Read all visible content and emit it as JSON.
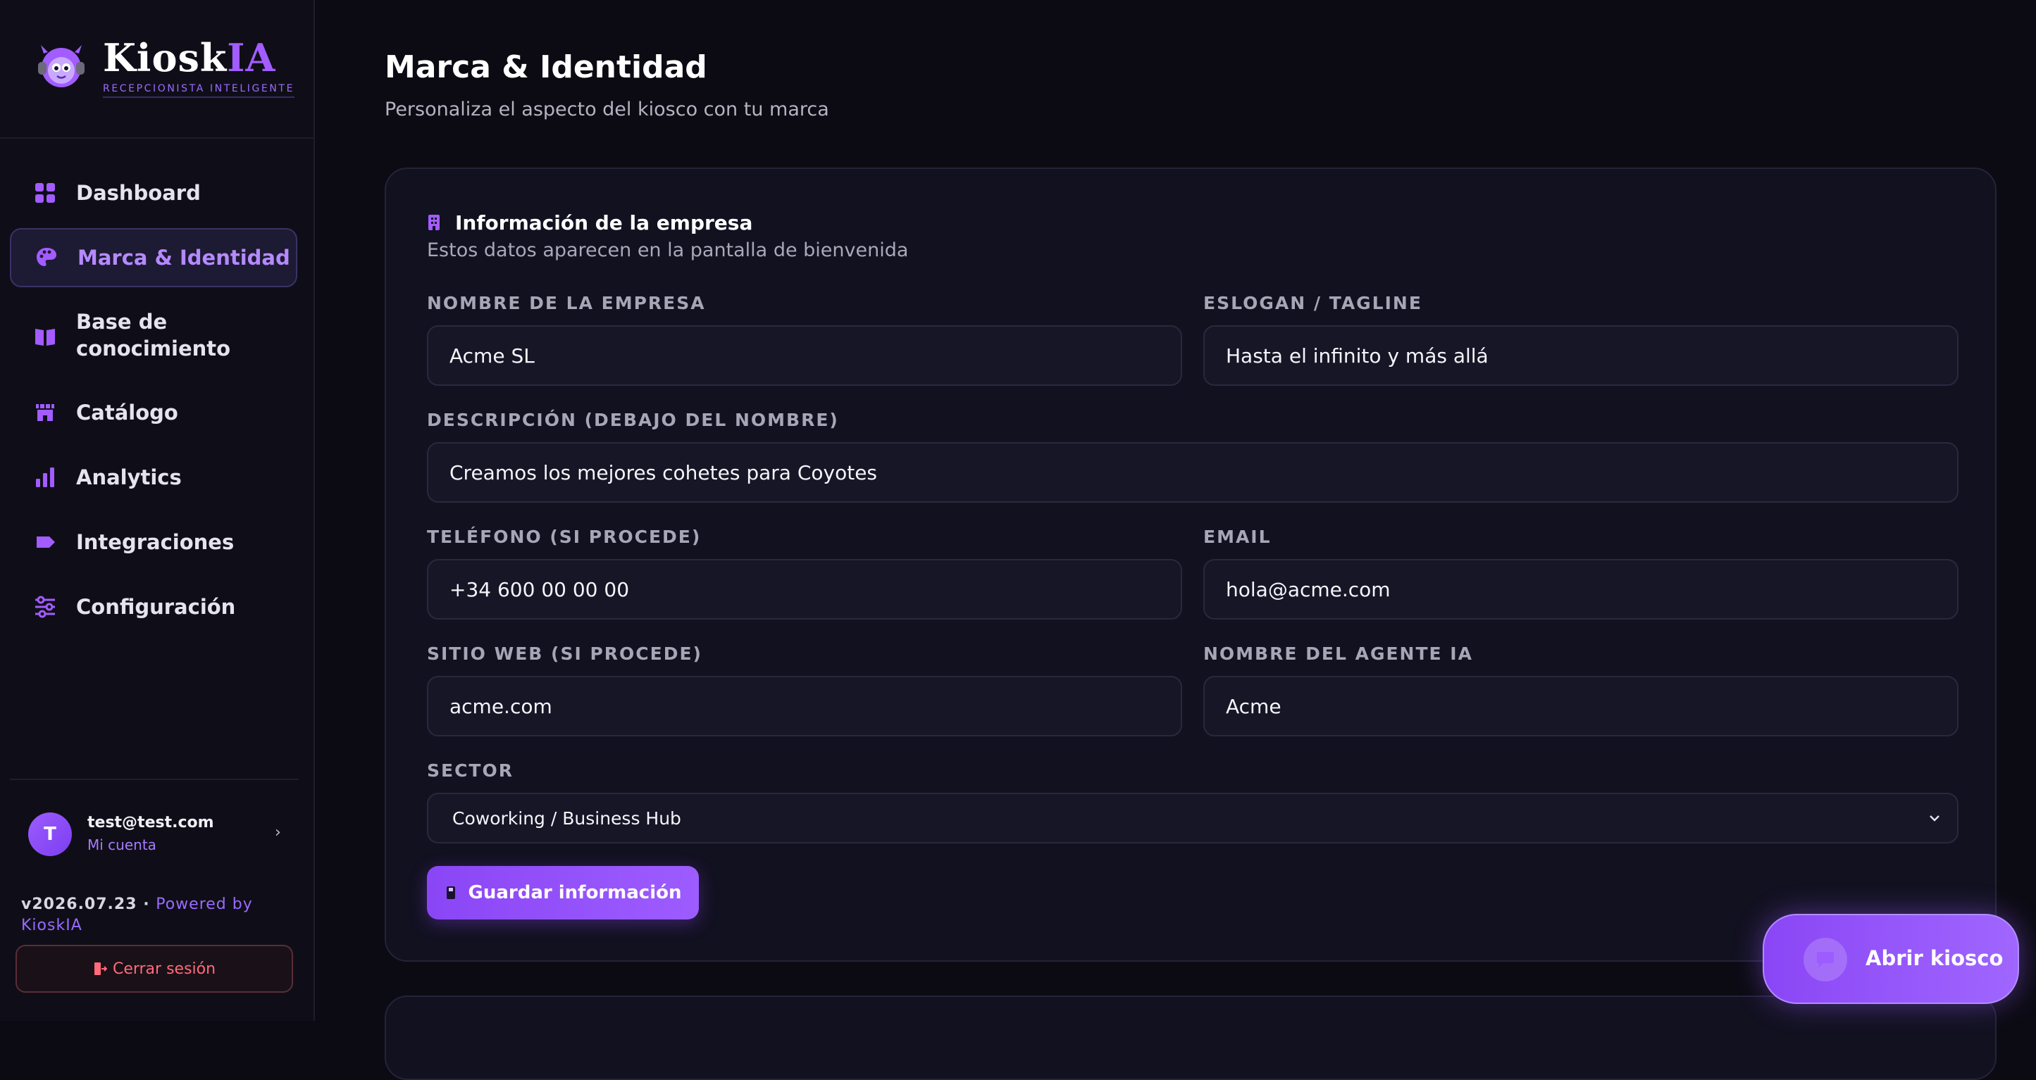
{
  "brand": {
    "name_main": "Kiosk",
    "name_accent": "IA",
    "subtitle": "RECEPCIONISTA INTELIGENTE"
  },
  "sidebar": {
    "items": [
      {
        "label": "Dashboard",
        "icon": "grid-icon",
        "active": false
      },
      {
        "label": "Marca & Identidad",
        "icon": "palette-icon",
        "active": true
      },
      {
        "label": "Base de\nconocimiento",
        "icon": "book-icon",
        "active": false
      },
      {
        "label": "Catálogo",
        "icon": "store-icon",
        "active": false
      },
      {
        "label": "Analytics",
        "icon": "bar-chart-icon",
        "active": false
      },
      {
        "label": "Integraciones",
        "icon": "plug-icon",
        "active": false
      },
      {
        "label": "Configuración",
        "icon": "sliders-icon",
        "active": false
      }
    ],
    "user": {
      "initial": "T",
      "email": "test@test.com",
      "account_label": "Mi cuenta"
    },
    "version": "v2026.07.23",
    "powered_by": "Powered by KioskIA",
    "logout_label": "Cerrar sesión"
  },
  "main": {
    "title": "Marca & Identidad",
    "subtitle": "Personaliza el aspecto del kiosco con tu marca",
    "card": {
      "title": "Información de la empresa",
      "description": "Estos datos aparecen en la pantalla de bienvenida",
      "fields": {
        "company_name": {
          "label": "NOMBRE DE LA EMPRESA",
          "value": "Acme SL"
        },
        "tagline": {
          "label": "ESLOGAN / TAGLINE",
          "value": "Hasta el infinito y más allá"
        },
        "description": {
          "label": "DESCRIPCIÓN (DEBAJO DEL NOMBRE)",
          "value": "Creamos los mejores cohetes para Coyotes"
        },
        "phone": {
          "label": "TELÉFONO (SI PROCEDE)",
          "value": "+34 600 00 00 00"
        },
        "email": {
          "label": "EMAIL",
          "value": "hola@acme.com"
        },
        "website": {
          "label": "SITIO WEB (SI PROCEDE)",
          "value": "acme.com"
        },
        "agent_name": {
          "label": "NOMBRE DEL AGENTE IA",
          "value": "Acme"
        },
        "sector": {
          "label": "SECTOR",
          "value": "Coworking / Business Hub"
        }
      },
      "save_label": "Guardar información"
    },
    "open_kiosk_label": "Abrir kiosco"
  },
  "colors": {
    "accent": "#9d5cff",
    "background": "#0c0b13",
    "card": "#121120",
    "danger": "#ff6b7a"
  }
}
